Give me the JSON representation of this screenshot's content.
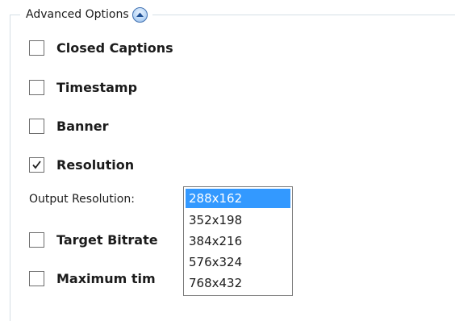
{
  "group": {
    "title": "Advanced Options",
    "toggle_icon": "chevron-up-icon",
    "accent_color": "#3399ff"
  },
  "options": [
    {
      "label": "Closed Captions",
      "checked": false
    },
    {
      "label": "Timestamp",
      "checked": false
    },
    {
      "label": "Banner",
      "checked": false
    },
    {
      "label": "Resolution",
      "checked": true
    },
    {
      "label": "Target Bitrate",
      "checked": false
    },
    {
      "label": "Maximum tim",
      "checked": false
    }
  ],
  "output_resolution": {
    "label": "Output Resolution:",
    "selected": "288x162",
    "options": [
      "288x162",
      "352x198",
      "384x216",
      "576x324",
      "768x432"
    ]
  }
}
